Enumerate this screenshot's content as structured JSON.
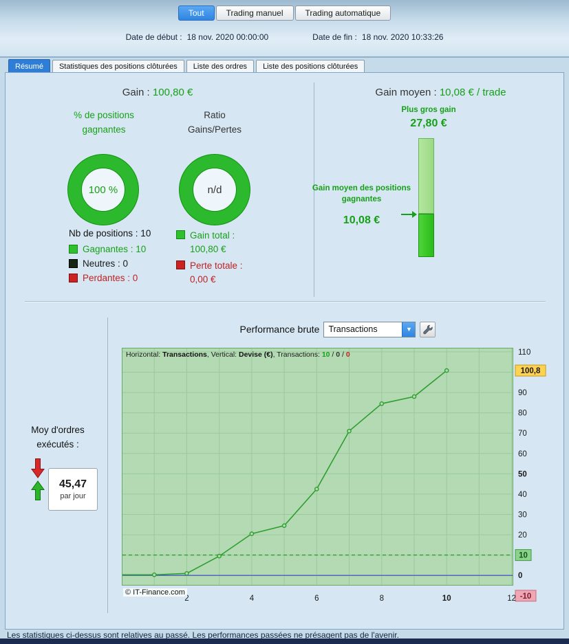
{
  "colors": {
    "green": "#17a017",
    "red": "#c22020",
    "accent_blue": "#2f85e0",
    "plot_bg": "#b3dab3",
    "grid": "#9aca9a",
    "line": "#2f9e2f",
    "zero_line": "#4a5ac2",
    "dashed_level": "#2fa02f",
    "box_yellow": "#ffd34f",
    "box_green": "#8bd28b",
    "box_pink": "#f0a6b4"
  },
  "header": {
    "filter_tabs": [
      {
        "label": "Tout"
      },
      {
        "label": "Trading manuel"
      },
      {
        "label": "Trading automatique"
      }
    ],
    "date_start_label": "Date de début :",
    "date_start_value": "18 nov. 2020 00:00:00",
    "date_end_label": "Date de fin :",
    "date_end_value": "18 nov. 2020 10:33:26"
  },
  "tabs": [
    {
      "label": "Résumé"
    },
    {
      "label": "Statistiques des positions clôturées"
    },
    {
      "label": "Liste des ordres"
    },
    {
      "label": "Liste des positions clôturées"
    }
  ],
  "summary": {
    "gain_label": "Gain :",
    "gain_value": "100,80 €",
    "pct_title": "% de positions gagnantes",
    "pct_value": "100 %",
    "ratio_title": "Ratio Gains/Pertes",
    "ratio_value": "n/d",
    "nb_positions": "Nb de positions : 10",
    "legend": [
      {
        "label": "Gagnantes : 10",
        "color": "#2fbf2f"
      },
      {
        "label": "Neutres : 0",
        "color": "#162516"
      },
      {
        "label": "Perdantes : 0",
        "color": "#cc2222"
      }
    ],
    "gain_total_label": "Gain total :",
    "gain_total_value": "100,80 €",
    "perte_totale_label": "Perte totale :",
    "perte_totale_value": "0,00 €"
  },
  "average": {
    "gain_moyen_label": "Gain moyen :",
    "gain_moyen_value": "10,08 € / trade",
    "plus_gros_gain_label": "Plus gros gain",
    "plus_gros_gain_value": "27,80 €",
    "bar_annotation_label": "Gain moyen des positions gagnantes",
    "bar_annotation_value": "10,08 €",
    "bar_max": 27.8,
    "bar_avg": 10.08
  },
  "performance": {
    "title": "Performance brute",
    "select_value": "Transactions",
    "orders_label_line1": "Moy d'ordres",
    "orders_label_line2": "exécutés :",
    "orders_value": "45,47",
    "orders_unit": "par jour",
    "copyright": "© IT-Finance.com"
  },
  "chart_data": {
    "type": "line",
    "title": "Performance brute",
    "xlabel": "Transactions",
    "ylabel": "Devise (€)",
    "x": [
      1,
      2,
      3,
      4,
      5,
      6,
      7,
      8,
      9,
      10
    ],
    "y": [
      0.3,
      1,
      9.5,
      20.5,
      24.5,
      42.5,
      71,
      84.5,
      88,
      100.8
    ],
    "xlim": [
      0,
      12.05
    ],
    "ylim": [
      -5,
      112
    ],
    "grid": true,
    "xticks": [
      2,
      4,
      6,
      8,
      10,
      12
    ],
    "xticks_bold": [
      10
    ],
    "yticks": [
      110,
      90,
      80,
      70,
      60,
      50,
      40,
      30,
      20,
      0
    ],
    "yticks_bold": [
      50,
      0
    ],
    "ytick_boxes": [
      {
        "value": 100.8,
        "label": "100,8",
        "bg": "#ffd34f",
        "fg": "#1a1a1a",
        "border": "#c39b1e"
      },
      {
        "value": 10,
        "label": "10",
        "bg": "#8bd28b",
        "fg": "#14541a",
        "border": "#3f9a3f"
      },
      {
        "value": -10,
        "label": "-10",
        "bg": "#f0a6b4",
        "fg": "#7c202e",
        "border": "#c4707f"
      }
    ],
    "levels": [
      {
        "value": 10,
        "style": "dashed",
        "color": "#2fa02f"
      },
      {
        "value": 0,
        "style": "solid",
        "color": "#4a5ac2"
      }
    ],
    "info_segments": [
      {
        "text": "Horizontal: ",
        "style": "plain"
      },
      {
        "text": "Transactions",
        "style": "bold"
      },
      {
        "text": ", Vertical: ",
        "style": "plain"
      },
      {
        "text": "Devise (€)",
        "style": "bold"
      },
      {
        "text": ", Transactions: ",
        "style": "plain"
      },
      {
        "text": "10",
        "style": "green"
      },
      {
        "text": " / ",
        "style": "plain"
      },
      {
        "text": "0",
        "style": "neutral"
      },
      {
        "text": " / ",
        "style": "plain"
      },
      {
        "text": "0",
        "style": "red"
      }
    ]
  },
  "footer": {
    "disclaimer": "Les statistiques ci-dessus sont relatives au passé. Les performances passées ne présagent pas de l'avenir."
  }
}
